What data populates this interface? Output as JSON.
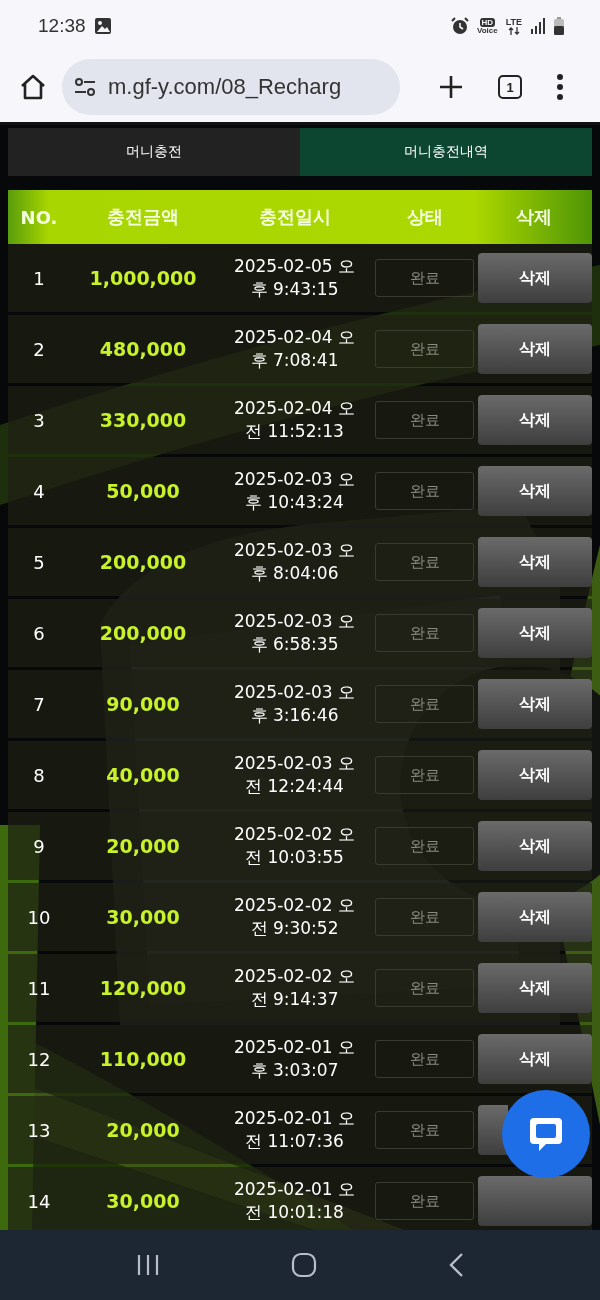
{
  "status_bar": {
    "time": "12:38",
    "hd": "HD",
    "voice": "Voice",
    "network": "LTE"
  },
  "browser": {
    "url": "m.gf-y.com/08_Recharg",
    "tab_count": "1"
  },
  "tabs": [
    {
      "label": "머니충전",
      "selected": false
    },
    {
      "label": "머니충전내역",
      "selected": true
    }
  ],
  "table": {
    "columns": [
      "NO.",
      "충전금액",
      "충전일시",
      "상태",
      "삭제"
    ],
    "rows": [
      {
        "no": "1",
        "amount": "1,000,000",
        "datetime": [
          "2025-02-05 오",
          "후 9:43:15"
        ],
        "status": "완료",
        "delete": "삭제"
      },
      {
        "no": "2",
        "amount": "480,000",
        "datetime": [
          "2025-02-04 오",
          "후 7:08:41"
        ],
        "status": "완료",
        "delete": "삭제"
      },
      {
        "no": "3",
        "amount": "330,000",
        "datetime": [
          "2025-02-04 오",
          "전 11:52:13"
        ],
        "status": "완료",
        "delete": "삭제"
      },
      {
        "no": "4",
        "amount": "50,000",
        "datetime": [
          "2025-02-03 오",
          "후 10:43:24"
        ],
        "status": "완료",
        "delete": "삭제"
      },
      {
        "no": "5",
        "amount": "200,000",
        "datetime": [
          "2025-02-03 오",
          "후 8:04:06"
        ],
        "status": "완료",
        "delete": "삭제"
      },
      {
        "no": "6",
        "amount": "200,000",
        "datetime": [
          "2025-02-03 오",
          "후 6:58:35"
        ],
        "status": "완료",
        "delete": "삭제"
      },
      {
        "no": "7",
        "amount": "90,000",
        "datetime": [
          "2025-02-03 오",
          "후 3:16:46"
        ],
        "status": "완료",
        "delete": "삭제"
      },
      {
        "no": "8",
        "amount": "40,000",
        "datetime": [
          "2025-02-03 오",
          "전 12:24:44"
        ],
        "status": "완료",
        "delete": "삭제"
      },
      {
        "no": "9",
        "amount": "20,000",
        "datetime": [
          "2025-02-02 오",
          "전 10:03:55"
        ],
        "status": "완료",
        "delete": "삭제"
      },
      {
        "no": "10",
        "amount": "30,000",
        "datetime": [
          "2025-02-02 오",
          "전 9:30:52"
        ],
        "status": "완료",
        "delete": "삭제"
      },
      {
        "no": "11",
        "amount": "120,000",
        "datetime": [
          "2025-02-02 오",
          "전 9:14:37"
        ],
        "status": "완료",
        "delete": "삭제"
      },
      {
        "no": "12",
        "amount": "110,000",
        "datetime": [
          "2025-02-01 오",
          "후 3:03:07"
        ],
        "status": "완료",
        "delete": "삭제"
      },
      {
        "no": "13",
        "amount": "20,000",
        "datetime": [
          "2025-02-01 오",
          "전 11:07:36"
        ],
        "status": "완료",
        "delete_hidden": true
      },
      {
        "no": "14",
        "amount": "30,000",
        "datetime": [
          "2025-02-01 오",
          "전 10:01:18"
        ],
        "status": "완료"
      }
    ]
  }
}
